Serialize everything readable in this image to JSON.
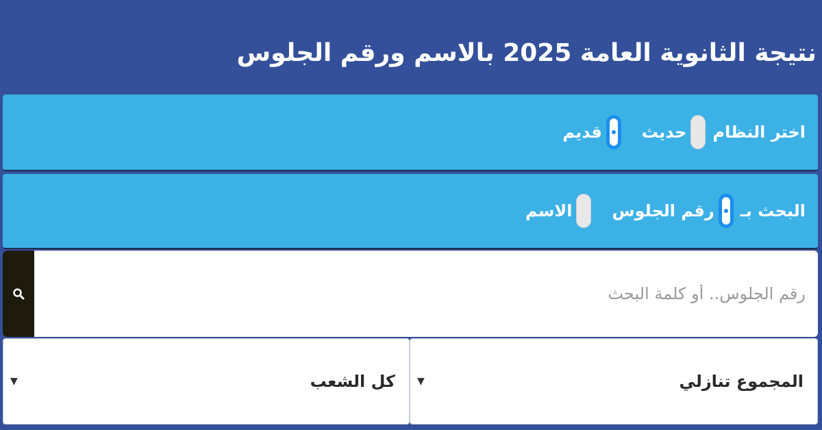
{
  "header": {
    "title": "نتيجة الثانوية العامة 2025 بالاسم ورقم الجلوس"
  },
  "system_selector": {
    "label": "اختر النظام",
    "options": [
      {
        "label": "حديث",
        "selected": false
      },
      {
        "label": "قديم",
        "selected": true
      }
    ]
  },
  "search_by": {
    "label": "البحث بـ",
    "options": [
      {
        "label": "رقم الجلوس",
        "selected": true
      },
      {
        "label": "الاسم",
        "selected": false
      }
    ]
  },
  "search": {
    "placeholder": "رقم الجلوس.. أو كلمة البحث",
    "value": "",
    "button_icon": "search-icon"
  },
  "filters": {
    "sort": {
      "value": "المجموع تنازلي",
      "icon": "chevron-down-icon"
    },
    "division": {
      "value": "كل الشعب",
      "icon": "chevron-down-icon"
    }
  },
  "colors": {
    "background": "#34509a",
    "panel": "#3cb1e6",
    "radio_checked": "#1a8ff0",
    "search_button": "#1e1a0c"
  }
}
